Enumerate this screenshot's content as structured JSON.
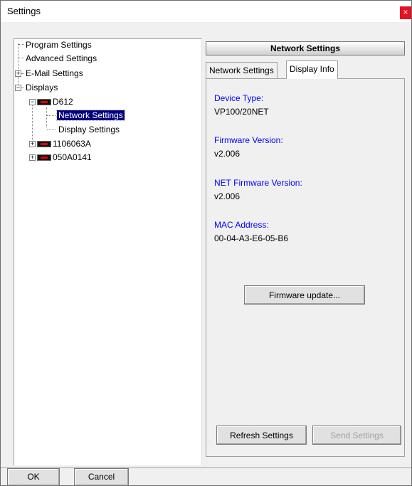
{
  "window": {
    "title": "Settings",
    "close_symbol": "×"
  },
  "tree": {
    "items": [
      {
        "label": "Program Settings"
      },
      {
        "label": "Advanced Settings"
      },
      {
        "label": "E-Mail Settings"
      },
      {
        "label": "Displays"
      },
      {
        "label": "D612"
      },
      {
        "label": "Network Settings"
      },
      {
        "label": "Display Settings"
      },
      {
        "label": "1106063A"
      },
      {
        "label": "050A0141"
      }
    ]
  },
  "panel": {
    "header": "Network Settings",
    "tabs": [
      {
        "label": "Network Settings"
      },
      {
        "label": "Display Info"
      }
    ],
    "fields": [
      {
        "label": "Device Type:",
        "value": "VP100/20NET"
      },
      {
        "label": "Firmware Version:",
        "value": "v2.006"
      },
      {
        "label": "NET Firmware Version:",
        "value": "v2.006"
      },
      {
        "label": "MAC Address:",
        "value": "00-04-A3-E6-05-B6"
      }
    ],
    "firmware_update_label": "Firmware update...",
    "refresh_label": "Refresh Settings",
    "send_label": "Send Settings"
  },
  "footer": {
    "ok_label": "OK",
    "cancel_label": "Cancel"
  },
  "colors": {
    "selection": "#000080",
    "field_label": "#0000ff",
    "close": "#e81123"
  },
  "icons": {
    "tree_expand": "plus-box-icon",
    "tree_collapse": "minus-box-icon",
    "device": "led-display-icon"
  }
}
